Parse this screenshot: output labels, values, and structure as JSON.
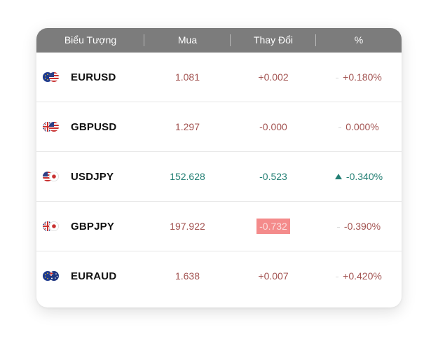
{
  "header": {
    "symbol": "Biểu Tượng",
    "bid": "Mua",
    "change": "Thay Đổi",
    "percent": "%"
  },
  "rows": [
    {
      "symbol": "EURUSD",
      "bid": "1.081",
      "change": "+0.002",
      "percent": "+0.180%",
      "trend": "neutral",
      "flags": [
        "eu-flag-icon",
        "us-flag-icon"
      ]
    },
    {
      "symbol": "GBPUSD",
      "bid": "1.297",
      "change": "-0.000",
      "percent": "0.000%",
      "trend": "neutral",
      "flags": [
        "uk-flag-icon",
        "us-flag-icon"
      ]
    },
    {
      "symbol": "USDJPY",
      "bid": "152.628",
      "change": "-0.523",
      "percent": "-0.340%",
      "trend": "up",
      "flags": [
        "us-flag-icon",
        "jp-flag-icon"
      ]
    },
    {
      "symbol": "GBPJPY",
      "bid": "197.922",
      "change": "-0.732",
      "percent": "-0.390%",
      "trend": "neutral",
      "flags": [
        "uk-flag-icon",
        "jp-flag-icon"
      ],
      "change_highlight": true
    },
    {
      "symbol": "EURAUD",
      "bid": "1.638",
      "change": "+0.007",
      "percent": "+0.420%",
      "trend": "neutral",
      "flags": [
        "eu-flag-icon",
        "au-flag-icon"
      ]
    }
  ],
  "colors": {
    "header_bg": "#7c7c7c",
    "negative_red": "#a35452",
    "positive_green": "#237f74",
    "flash_bg": "#f48b8b"
  }
}
